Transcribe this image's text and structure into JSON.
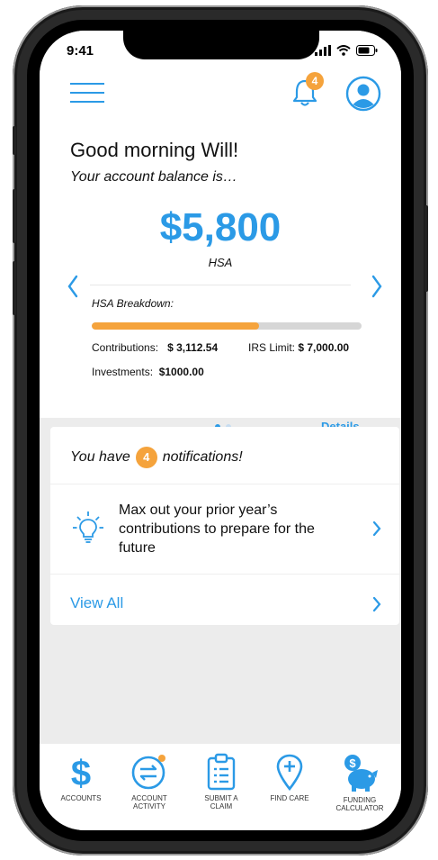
{
  "status_bar": {
    "time": "9:41"
  },
  "header": {
    "notification_count": "4"
  },
  "greeting": "Good morning Will!",
  "subgreeting": "Your account balance is…",
  "balance": {
    "amount": "$5,800",
    "account_type": "HSA"
  },
  "breakdown": {
    "title": "HSA Breakdown:",
    "progress_fraction": 0.62,
    "contributions_label": "Contributions:",
    "contributions_value": "$ 3,112.54",
    "irs_limit_label": "IRS Limit:",
    "irs_limit_value": "$ 7,000.00",
    "investments_label": "Investments:",
    "investments_value": "$1000.00",
    "details_link": "Details"
  },
  "notifications": {
    "prefix": "You have",
    "count": "4",
    "suffix": "notifications!",
    "item_message": "Max out your prior year’s contributions to prepare for the future",
    "view_all": "View All"
  },
  "tabs": [
    {
      "label_line1": "ACCOUNTS",
      "label_line2": ""
    },
    {
      "label_line1": "ACCOUNT",
      "label_line2": "ACTIVITY"
    },
    {
      "label_line1": "SUBMIT A",
      "label_line2": "CLAIM"
    },
    {
      "label_line1": "FIND CARE",
      "label_line2": ""
    },
    {
      "label_line1": "FUNDING",
      "label_line2": "CALCULATOR"
    }
  ],
  "colors": {
    "accent_blue": "#2b9ae6",
    "accent_orange": "#f5a33c"
  }
}
